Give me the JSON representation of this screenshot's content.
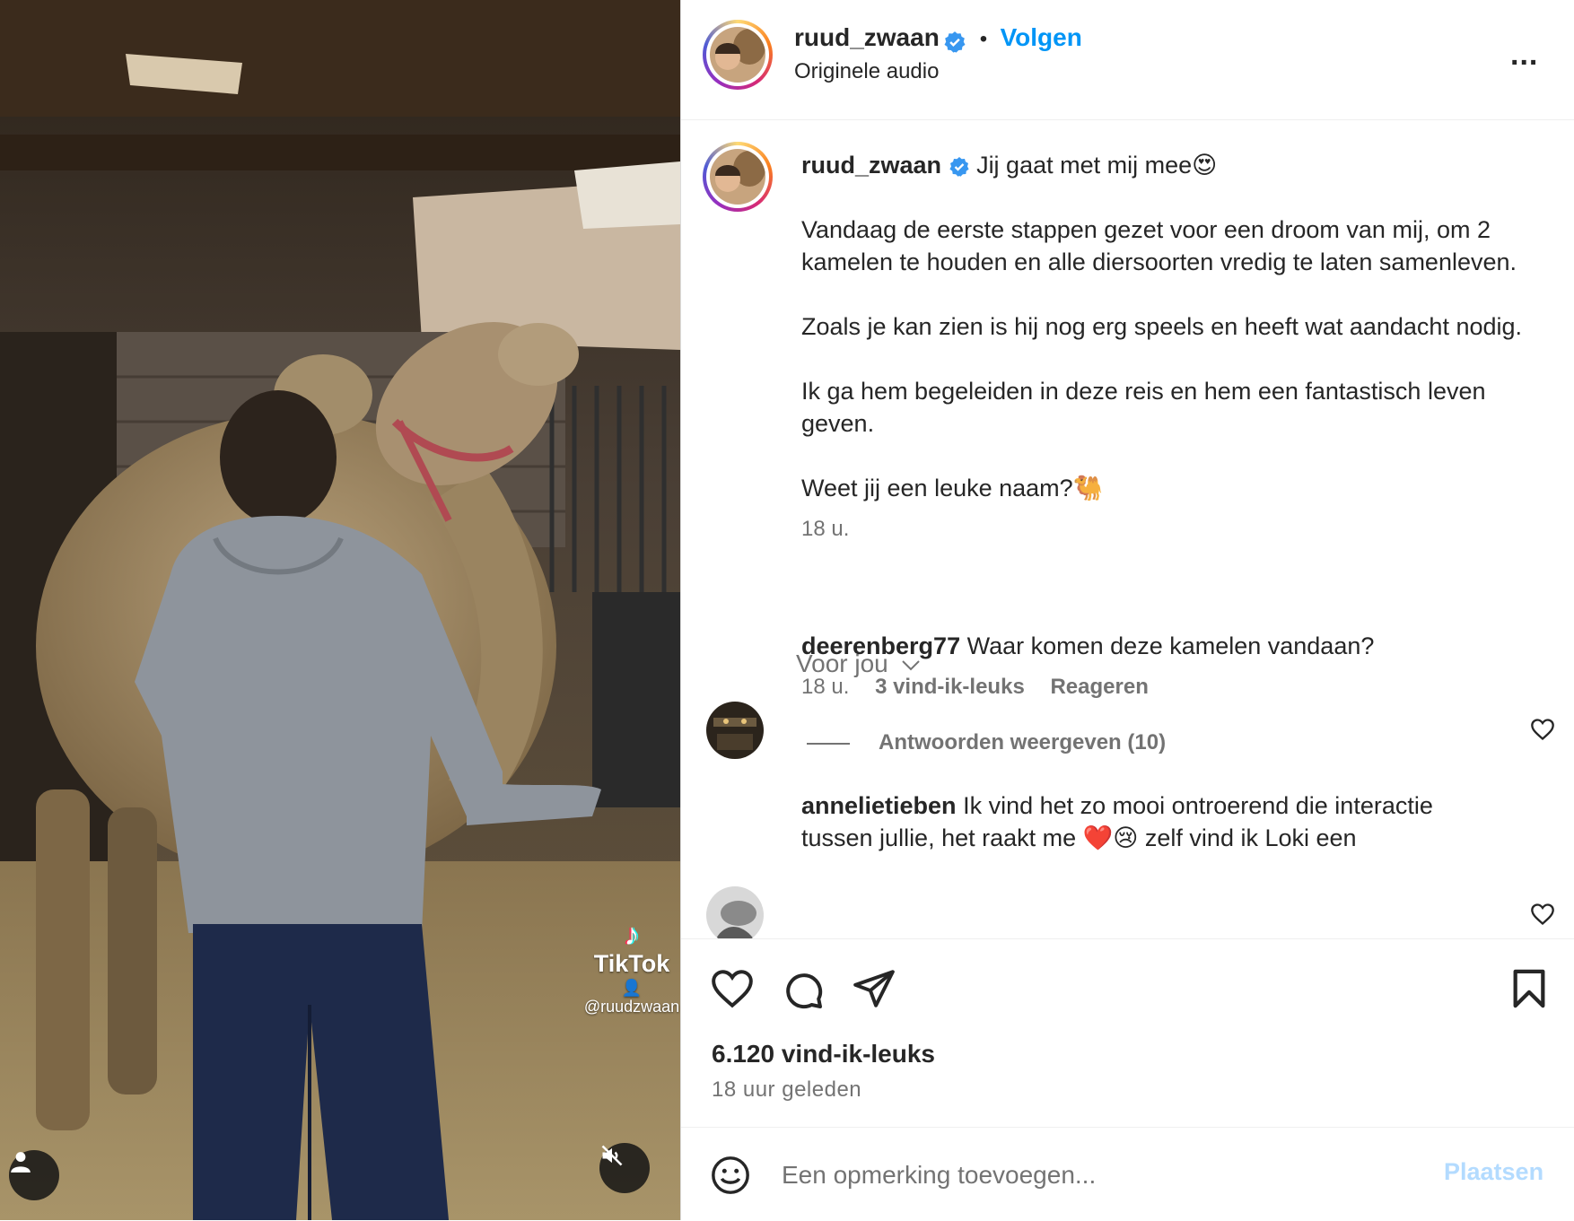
{
  "media": {
    "watermark_brand": "TikTok",
    "watermark_handle": "@ruudzwaan"
  },
  "header": {
    "username": "ruud_zwaan",
    "separator": "•",
    "follow_label": "Volgen",
    "audio_label": "Originele audio",
    "more_label": "..."
  },
  "caption": {
    "username": "ruud_zwaan",
    "lines": [
      "Jij gaat met mij mee😍",
      "Vandaag de eerste stappen gezet voor een droom van mij, om 2 kamelen te houden en alle diersoorten vredig te laten samenleven.",
      "Zoals je kan zien is hij nog erg speels en heeft wat aandacht nodig.",
      "Ik ga hem begeleiden in deze reis en hem een fantastisch leven geven.",
      "Weet jij een leuke naam?🐫"
    ],
    "time": "18 u."
  },
  "sort_label": "Voor jou",
  "comments": [
    {
      "username": "deerenberg77",
      "text": "Waar komen deze kamelen vandaan?",
      "time": "18 u.",
      "likes": "3 vind-ik-leuks",
      "reply_label": "Reageren",
      "view_replies": "Antwoorden weergeven (10)"
    },
    {
      "username": "annelietieben",
      "text": "Ik vind het zo mooi ontroerend die interactie tussen jullie, het raakt me ❤️😢 zelf vind ik Loki een"
    }
  ],
  "footer": {
    "likes": "6.120 vind-ik-leuks",
    "time_ago": "18 uur geleden",
    "comment_placeholder": "Een opmerking toevoegen...",
    "post_label": "Plaatsen"
  },
  "colors": {
    "accent": "#0095f6",
    "post_disabled": "#b3dbff",
    "muted": "#737373"
  }
}
